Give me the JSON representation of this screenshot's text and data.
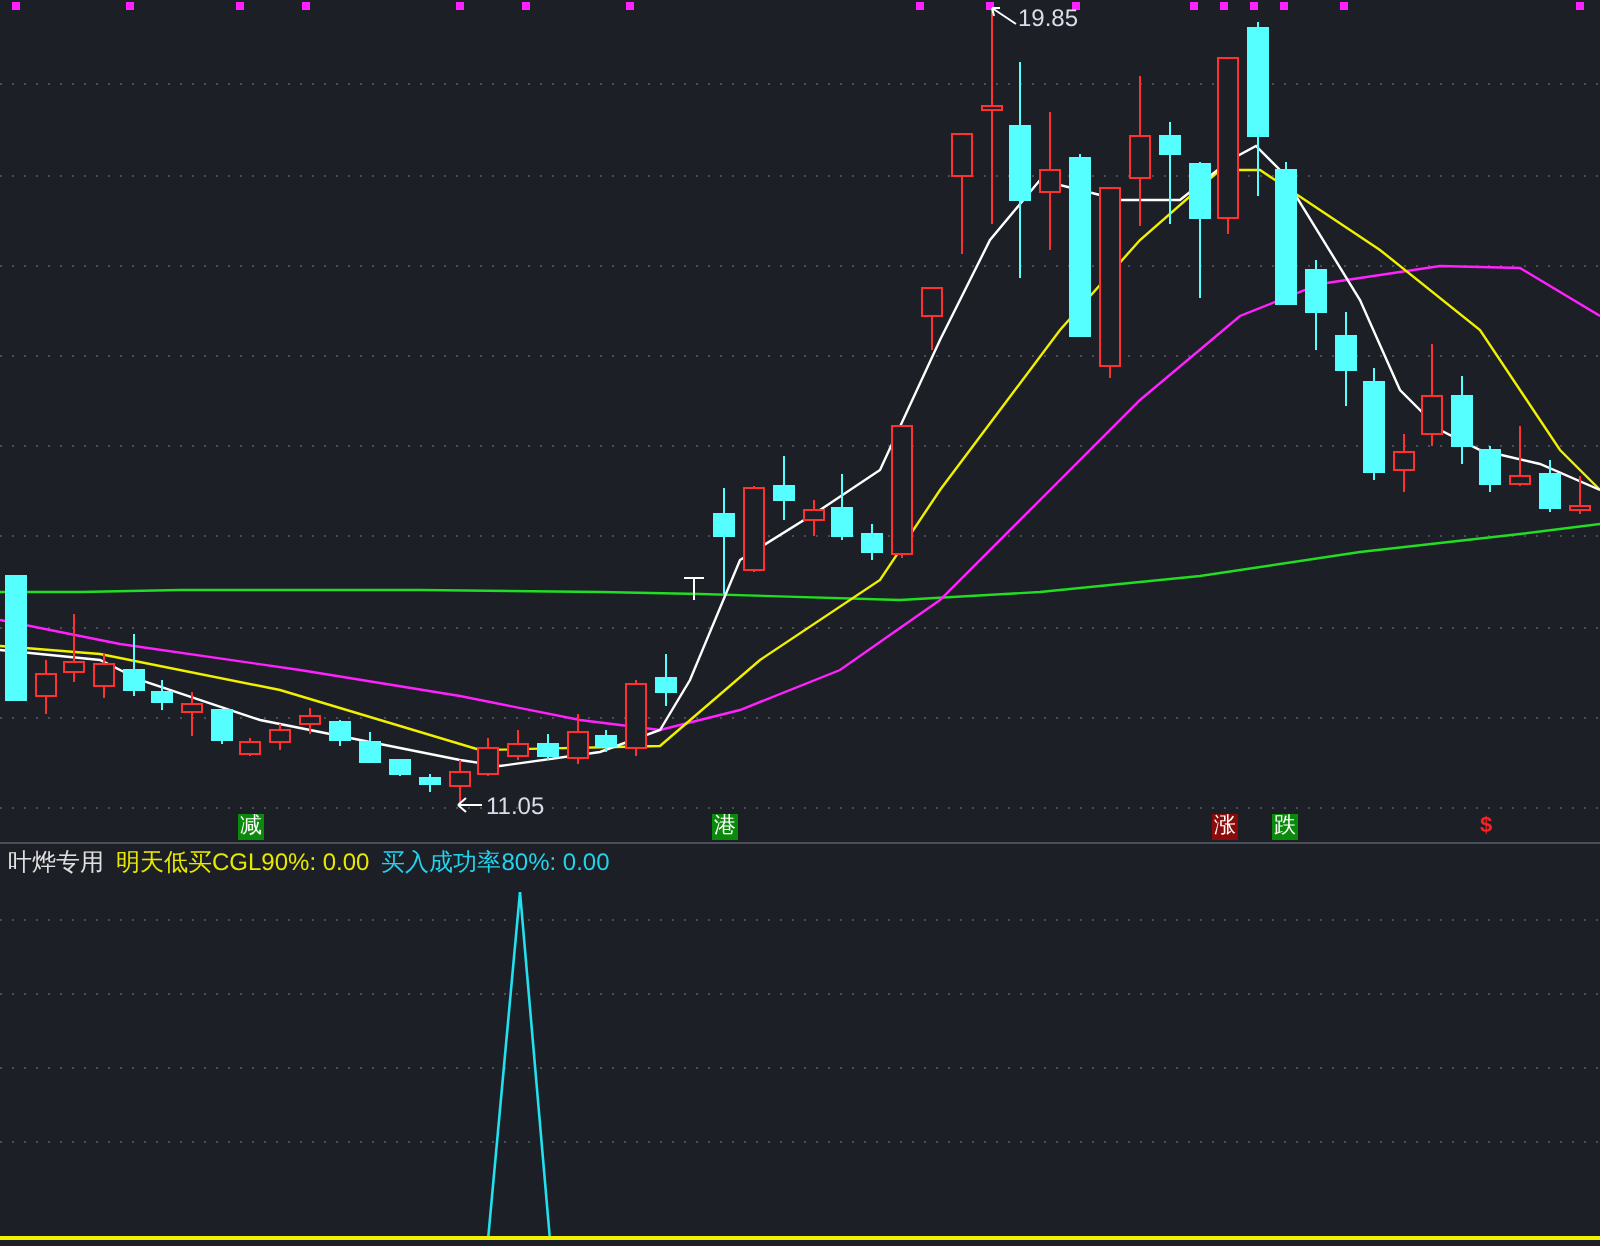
{
  "main_chart": {
    "high_label": "19.85",
    "low_label": "11.05",
    "signals": [
      {
        "text": "减",
        "color": "#0a8a0a",
        "kind": "box"
      },
      {
        "text": "港",
        "color": "#0a8a0a",
        "kind": "box"
      },
      {
        "text": "涨",
        "color": "#8b0a0a",
        "kind": "box"
      },
      {
        "text": "跌",
        "color": "#0a8a0a",
        "kind": "box"
      },
      {
        "text": "$",
        "color": "#ff2020",
        "kind": "arrow"
      }
    ]
  },
  "legend": [
    {
      "text": "叶烨专用",
      "color": "#e0e0e0"
    },
    {
      "text": "明天低买CGL90%: 0.00",
      "color": "#e8e800"
    },
    {
      "text": "买入成功率80%: 0.00",
      "color": "#22d3ee"
    }
  ]
}
